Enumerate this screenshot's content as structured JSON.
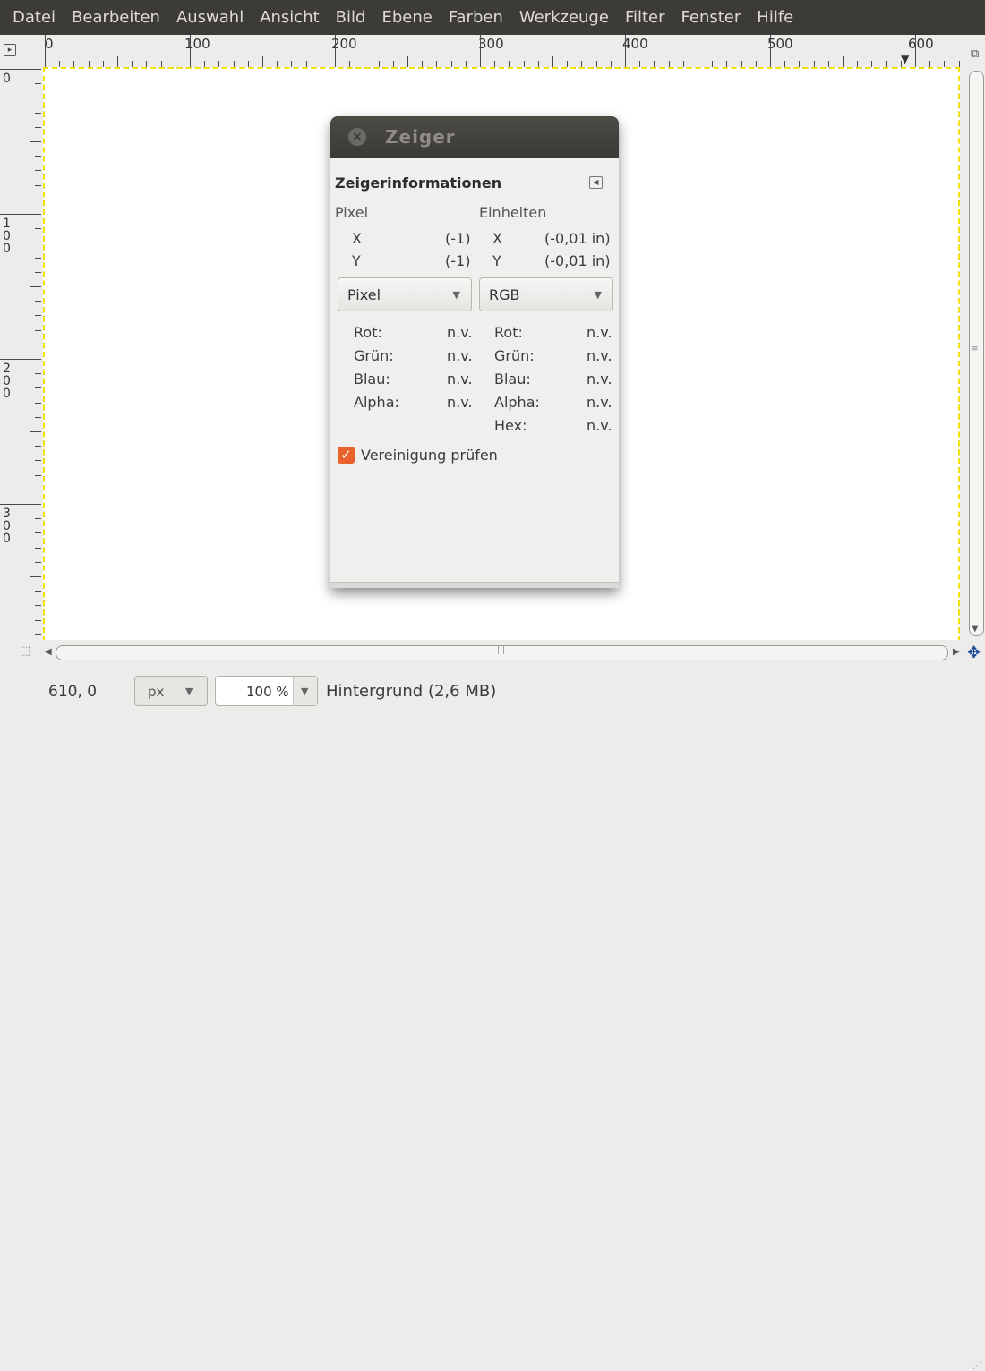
{
  "menubar": {
    "items": [
      "Datei",
      "Bearbeiten",
      "Auswahl",
      "Ansicht",
      "Bild",
      "Ebene",
      "Farben",
      "Werkzeuge",
      "Filter",
      "Fenster",
      "Hilfe"
    ]
  },
  "rulers": {
    "horizontal_labels": [
      "0",
      "100",
      "200",
      "300",
      "400",
      "500",
      "600"
    ],
    "vertical_labels": [
      "0",
      "100",
      "200",
      "300"
    ]
  },
  "dialog": {
    "title": "Zeiger",
    "section_title": "Zeigerinformationen",
    "pixel_header": "Pixel",
    "units_header": "Einheiten",
    "pixel_x_label": "X",
    "pixel_x_value": "(-1)",
    "pixel_y_label": "Y",
    "pixel_y_value": "(-1)",
    "units_x_label": "X",
    "units_x_value": "(-0,01 in)",
    "units_y_label": "Y",
    "units_y_value": "(-0,01 in)",
    "left_combo": "Pixel",
    "right_combo": "RGB",
    "left_rows": [
      {
        "label": "Rot:",
        "value": "n.v."
      },
      {
        "label": "Grün:",
        "value": "n.v."
      },
      {
        "label": "Blau:",
        "value": "n.v."
      },
      {
        "label": "Alpha:",
        "value": "n.v."
      }
    ],
    "right_rows": [
      {
        "label": "Rot:",
        "value": "n.v."
      },
      {
        "label": "Grün:",
        "value": "n.v."
      },
      {
        "label": "Blau:",
        "value": "n.v."
      },
      {
        "label": "Alpha:",
        "value": "n.v."
      },
      {
        "label": "Hex:",
        "value": "n.v."
      }
    ],
    "sample_merged_label": "Vereinigung prüfen",
    "sample_merged_checked": true
  },
  "statusbar": {
    "coordinates": "610, 0",
    "unit": "px",
    "zoom": "100 %",
    "layer_info": "Hintergrund (2,6 MB)"
  },
  "colors": {
    "menubar_bg": "#3c3b37",
    "accent_checkbox": "#e9612b",
    "navigate_icon": "#1f4e9c"
  }
}
